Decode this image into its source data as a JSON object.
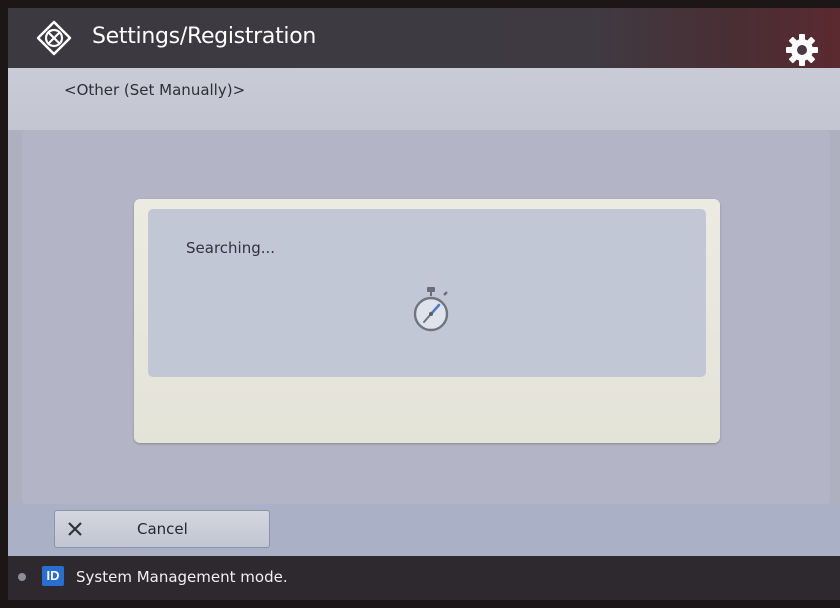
{
  "header": {
    "title": "Settings/Registration",
    "app_icon": "settings-registration-icon",
    "settings_icon": "gear-icon"
  },
  "breadcrumb": "<Other (Set Manually)>",
  "dialog": {
    "message": "Searching...",
    "icon": "stopwatch-icon"
  },
  "footer": {
    "cancel_label": "Cancel",
    "cancel_icon": "close-icon"
  },
  "status": {
    "badge": "ID",
    "text": "System Management mode."
  },
  "colors": {
    "titlebar": "#3c3940",
    "dialog_bg": "#ecebe2",
    "dialog_inner": "#c1c7d4",
    "id_badge": "#2a6fd0"
  }
}
